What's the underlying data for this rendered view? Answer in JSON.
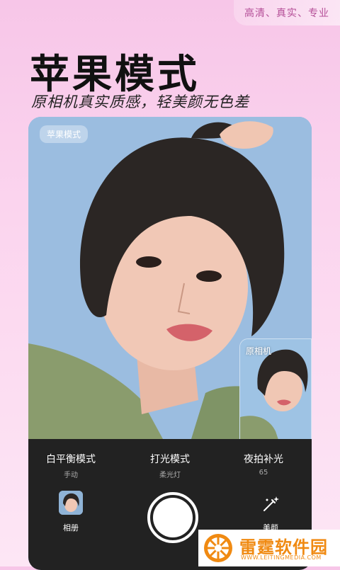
{
  "header": {
    "tagline": "高清、真实、专业",
    "title": "苹果模式",
    "subtitle": "原相机真实质感，轻美颜无色差"
  },
  "preview": {
    "mode_tag": "苹果模式",
    "inset_label": "原相机"
  },
  "controls": {
    "options": [
      {
        "name": "白平衡模式",
        "sub": "手动"
      },
      {
        "name": "打光模式",
        "sub": "柔光灯"
      },
      {
        "name": "夜拍补光",
        "sub": "65"
      }
    ],
    "album_label": "相册",
    "beauty_label": "美颜"
  },
  "watermark": {
    "text": "雷霆软件园",
    "sub": "WWW.LEITINGMEDIA.COM"
  },
  "colors": {
    "background": "#f7c6e8",
    "accent": "#b44e97",
    "panel": "#222222",
    "watermark_orange": "#f08a12"
  }
}
